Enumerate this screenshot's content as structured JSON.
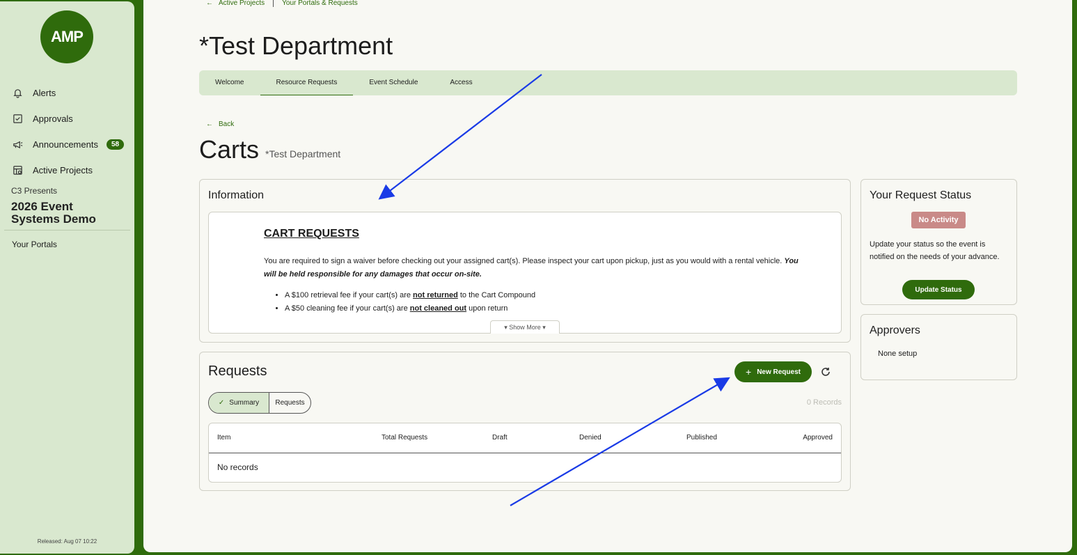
{
  "sidebar": {
    "logo_text": "AMP",
    "items": [
      {
        "label": "Alerts",
        "icon": "bell-icon"
      },
      {
        "label": "Approvals",
        "icon": "checkbox-icon"
      },
      {
        "label": "Announcements",
        "icon": "megaphone-icon",
        "badge": "58"
      },
      {
        "label": "Active Projects",
        "icon": "projects-icon"
      }
    ],
    "org_sub": "C3 Presents",
    "org_title": "2026 Event Systems Demo",
    "your_portals": "Your Portals",
    "released": "Released: Aug 07 10:22"
  },
  "breadcrumb": {
    "first": "Active Projects",
    "second": "Your Portals & Requests"
  },
  "department_title": "*Test Department",
  "tabs": [
    {
      "label": "Welcome"
    },
    {
      "label": "Resource Requests",
      "active": true
    },
    {
      "label": "Event Schedule"
    },
    {
      "label": "Access"
    }
  ],
  "back_label": "Back",
  "page_title": "Carts",
  "page_subtitle": "*Test Department",
  "information": {
    "title": "Information",
    "heading": "CART REQUESTS",
    "paragraph_main": "You are required to sign a waiver before checking out your assigned cart(s). Please inspect your cart upon pickup, just as you would with a rental vehicle.",
    "paragraph_emph": "You will be held responsible for any damages that occur on-site.",
    "bullet1_pre": "A $100 retrieval fee if your cart(s) are ",
    "bullet1_u": "not returned",
    "bullet1_post": " to the Cart Compound",
    "bullet2_pre": "A $50 cleaning fee if your cart(s) are ",
    "bullet2_u": "not cleaned out",
    "bullet2_post": " upon return",
    "show_more": "Show More"
  },
  "requests": {
    "title": "Requests",
    "new_request": "New Request",
    "toggle_summary": "Summary",
    "toggle_requests": "Requests",
    "records_count": "0 Records",
    "columns": [
      "Item",
      "Total Requests",
      "Draft",
      "Denied",
      "Published",
      "Approved"
    ],
    "empty": "No records"
  },
  "status": {
    "title": "Your Request Status",
    "badge": "No Activity",
    "text": "Update your status so the event is notified on the needs of your advance.",
    "button": "Update Status"
  },
  "approvers": {
    "title": "Approvers",
    "text": "None setup"
  },
  "colors": {
    "brand_green": "#2f6b0c",
    "light_green": "#d9e8cf",
    "no_activity": "#c98a88",
    "annotation_arrow": "#1a3be6"
  }
}
